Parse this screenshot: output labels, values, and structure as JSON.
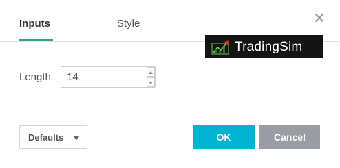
{
  "tabs": [
    {
      "label": "Inputs",
      "active": true
    },
    {
      "label": "Style",
      "active": false
    }
  ],
  "accent_color": "#2fa67f",
  "close_icon": "close-icon",
  "watermark": {
    "text": "TradingSim",
    "icon": "chart-logo-icon"
  },
  "form": {
    "length_label": "Length",
    "length_value": "14"
  },
  "footer": {
    "defaults_label": "Defaults",
    "ok_label": "OK",
    "cancel_label": "Cancel"
  },
  "colors": {
    "ok_button": "#00b3d3",
    "cancel_button": "#9a9da3"
  }
}
